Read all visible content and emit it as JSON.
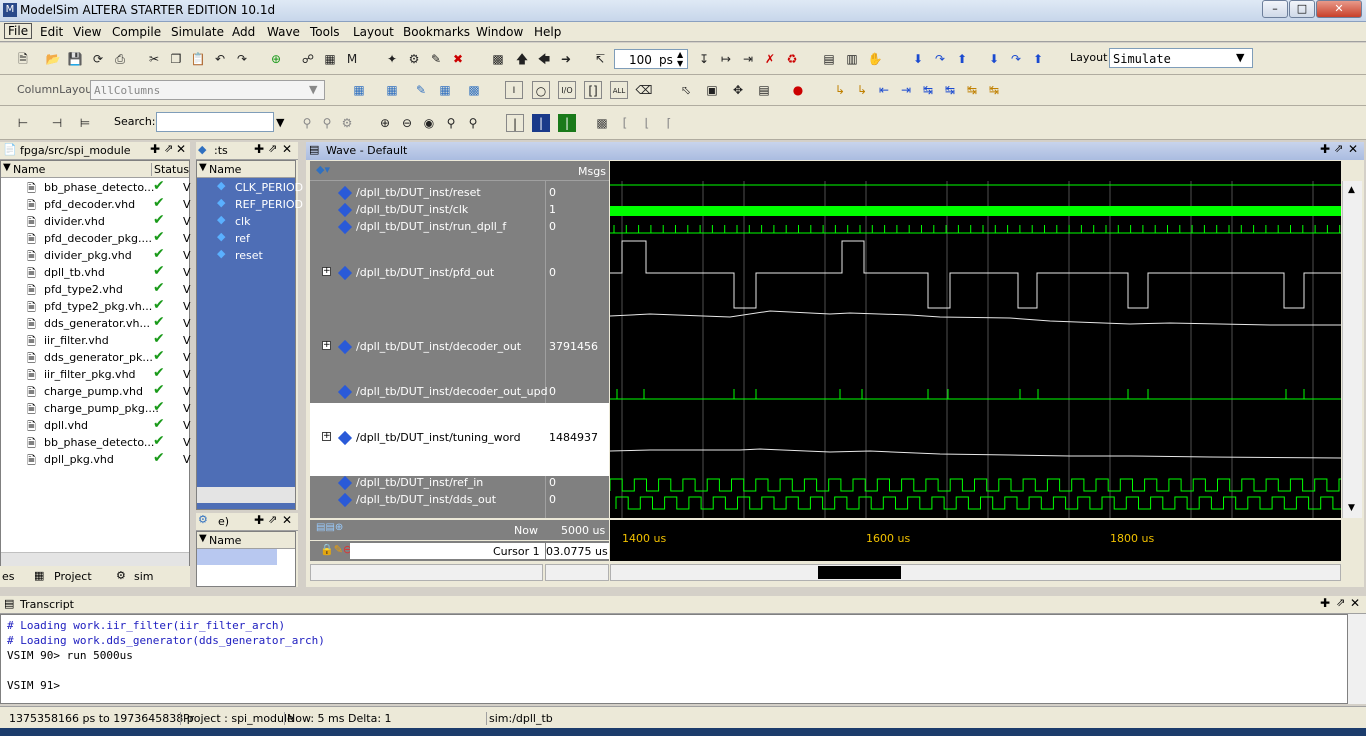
{
  "window": {
    "title": "ModelSim ALTERA STARTER EDITION 10.1d"
  },
  "menu": [
    "File",
    "Edit",
    "View",
    "Compile",
    "Simulate",
    "Add",
    "Wave",
    "Tools",
    "Layout",
    "Bookmarks",
    "Window",
    "Help"
  ],
  "toolbar": {
    "runtime_value": "100",
    "runtime_unit": "ps",
    "layout_label": "Layout",
    "layout_value": "Simulate",
    "column_layout_label": "ColumnLayout",
    "column_layout_value": "AllColumns",
    "search_label": "Search:"
  },
  "project": {
    "title": "fpga/src/spi_module",
    "col_name": "Name",
    "col_status": "Status",
    "files": [
      "bb_phase_detecto...",
      "pfd_decoder.vhd",
      "divider.vhd",
      "pfd_decoder_pkg....",
      "divider_pkg.vhd",
      "dpll_tb.vhd",
      "pfd_type2.vhd",
      "pfd_type2_pkg.vh...",
      "dds_generator.vh...",
      "iir_filter.vhd",
      "dds_generator_pk...",
      "iir_filter_pkg.vhd",
      "charge_pump.vhd",
      "charge_pump_pkg....",
      "dpll.vhd",
      "bb_phase_detecto...",
      "dpll_pkg.vhd"
    ],
    "tabs": [
      "es",
      "Project",
      "sim"
    ]
  },
  "objects": {
    "title": ":ts",
    "col_name": "Name",
    "items": [
      "CLK_PERIOD",
      "REF_PERIOD",
      "clk",
      "ref",
      "reset"
    ]
  },
  "process": {
    "title": "e)",
    "col_name": "Name"
  },
  "wave": {
    "title": "Wave - Default",
    "msgs": "Msgs",
    "signals": [
      {
        "name": "/dpll_tb/DUT_inst/reset",
        "value": "0"
      },
      {
        "name": "/dpll_tb/DUT_inst/clk",
        "value": "1"
      },
      {
        "name": "/dpll_tb/DUT_inst/run_dpll_f",
        "value": "0"
      },
      {
        "name": "/dpll_tb/DUT_inst/pfd_out",
        "value": "0"
      },
      {
        "name": "/dpll_tb/DUT_inst/decoder_out",
        "value": "3791456"
      },
      {
        "name": "/dpll_tb/DUT_inst/decoder_out_upd",
        "value": "0"
      },
      {
        "name": "/dpll_tb/DUT_inst/tuning_word",
        "value": "1484937"
      },
      {
        "name": "/dpll_tb/DUT_inst/ref_in",
        "value": "0"
      },
      {
        "name": "/dpll_tb/DUT_inst/dds_out",
        "value": "0"
      }
    ],
    "now_label": "Now",
    "now_value": "5000 us",
    "cursor_label": "Cursor 1",
    "cursor_value": "03.0775 us",
    "time_ticks": [
      "1400 us",
      "1600 us",
      "1800 us"
    ]
  },
  "transcript": {
    "title": "Transcript",
    "lines": [
      "# Loading work.iir_filter(iir_filter_arch)",
      "# Loading work.dds_generator(dds_generator_arch)",
      "VSIM 90> run 5000us",
      "",
      "VSIM 91>"
    ]
  },
  "status": {
    "range": "1375358166 ps to 1973645838 p",
    "project": "Project : spi_module",
    "now": "Now: 5 ms  Delta: 1",
    "sim": "sim:/dpll_tb"
  },
  "colors": {
    "wave_green": "#00ff00",
    "pane_blue": "#4e6eb6"
  }
}
